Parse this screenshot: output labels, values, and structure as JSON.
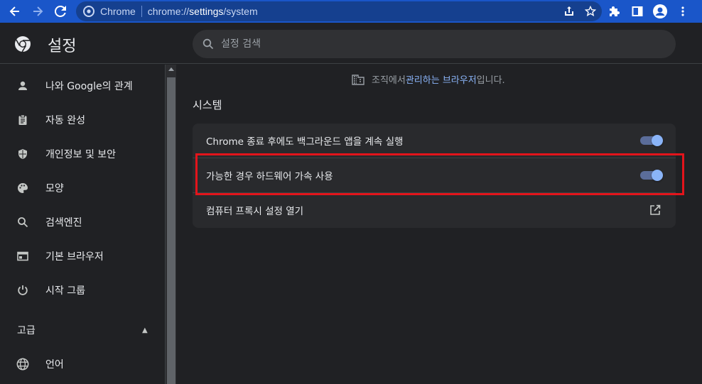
{
  "browser": {
    "origin_label": "Chrome",
    "url_prefix": "chrome://",
    "url_bold": "settings",
    "url_suffix": "/system"
  },
  "header": {
    "title": "설정",
    "search_placeholder": "설정 검색"
  },
  "sidebar": {
    "items": [
      {
        "label": "나와 Google의 관계",
        "icon": "person-icon"
      },
      {
        "label": "자동 완성",
        "icon": "clipboard-icon"
      },
      {
        "label": "개인정보 및 보안",
        "icon": "shield-icon"
      },
      {
        "label": "모양",
        "icon": "palette-icon"
      },
      {
        "label": "검색엔진",
        "icon": "search-icon"
      },
      {
        "label": "기본 브라우저",
        "icon": "browser-window-icon"
      },
      {
        "label": "시작 그룹",
        "icon": "power-icon"
      }
    ],
    "advanced_label": "고급",
    "advanced_items": [
      {
        "label": "언어",
        "icon": "globe-icon"
      }
    ]
  },
  "main": {
    "managed_prefix": "조직에서 ",
    "managed_link": "관리하는 브라우저",
    "managed_suffix": "입니다.",
    "section_title": "시스템",
    "rows": [
      {
        "label": "Chrome 종료 후에도 백그라운드 앱을 계속 실행",
        "control": "toggle",
        "on": true
      },
      {
        "label": "가능한 경우 하드웨어 가속 사용",
        "control": "toggle",
        "on": true
      },
      {
        "label": "컴퓨터 프록시 설정 열기",
        "control": "external-link"
      }
    ]
  },
  "colors": {
    "accent": "#8ab4f8",
    "highlight_box": "#e3141b",
    "topbar": "#1a56c9"
  }
}
